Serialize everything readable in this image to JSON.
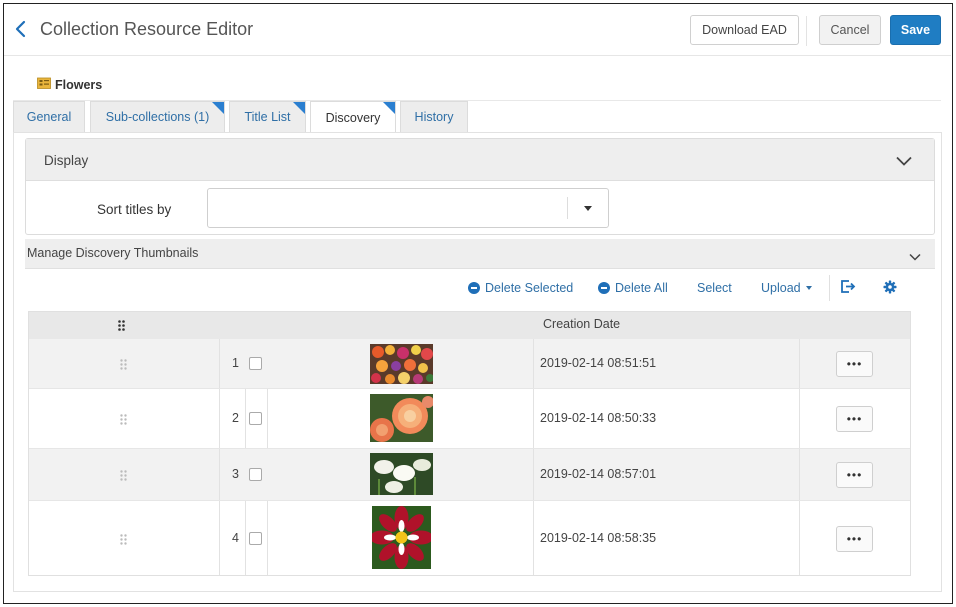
{
  "header": {
    "title": "Collection Resource Editor",
    "download_label": "Download EAD",
    "cancel_label": "Cancel",
    "save_label": "Save"
  },
  "breadcrumb": {
    "label": "Flowers",
    "icon": "collection-folder-icon"
  },
  "tabs": [
    {
      "label": "General",
      "active": false,
      "marked": false
    },
    {
      "label": "Sub-collections (1)",
      "active": false,
      "marked": true
    },
    {
      "label": "Title List",
      "active": false,
      "marked": true
    },
    {
      "label": "Discovery",
      "active": true,
      "marked": true
    },
    {
      "label": "History",
      "active": false,
      "marked": false
    }
  ],
  "display_section": {
    "title": "Display",
    "sort_label": "Sort titles by",
    "sort_value": ""
  },
  "thumbnails_section": {
    "title": "Manage Discovery Thumbnails",
    "toolbar": {
      "delete_selected": "Delete Selected",
      "delete_all": "Delete All",
      "select": "Select",
      "upload": "Upload"
    },
    "table": {
      "header_date": "Creation Date",
      "rows": [
        {
          "index": "1",
          "date": "2019-02-14 08:51:51",
          "image": "mixed-flower-bouquet"
        },
        {
          "index": "2",
          "date": "2019-02-14 08:50:33",
          "image": "orange-pink-rose"
        },
        {
          "index": "3",
          "date": "2019-02-14 08:57:01",
          "image": "white-calla-lilies"
        },
        {
          "index": "4",
          "date": "2019-02-14 08:58:35",
          "image": "red-white-dahlia"
        }
      ],
      "more_label": "•••"
    }
  },
  "colors": {
    "accent": "#1f7dc3",
    "link": "#2f6fa6",
    "tab_marker": "#2b7fd0"
  }
}
